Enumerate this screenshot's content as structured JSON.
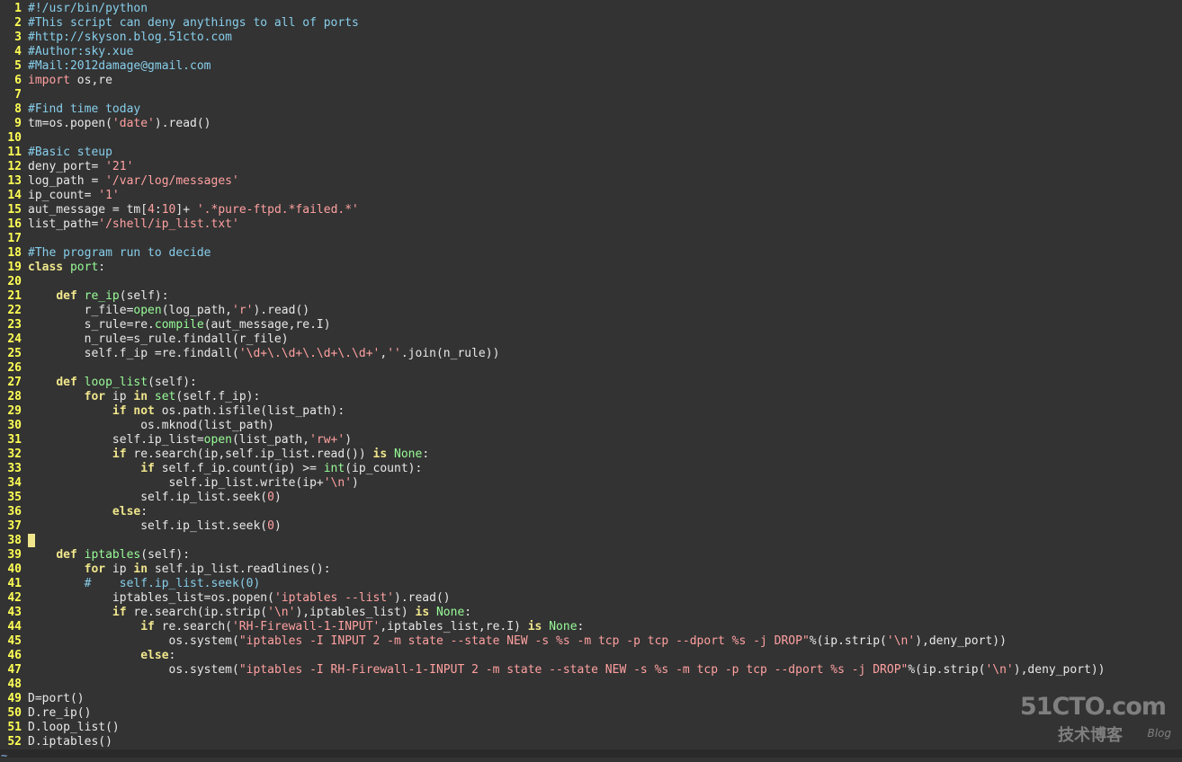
{
  "editor": {
    "lines": [
      {
        "n": "1",
        "code": [
          {
            "t": "cmt",
            "v": "#!/usr/bin/python"
          }
        ]
      },
      {
        "n": "2",
        "code": [
          {
            "t": "cmt",
            "v": "#This script can deny anythings to all of ports"
          }
        ]
      },
      {
        "n": "3",
        "code": [
          {
            "t": "cmt",
            "v": "#http://skyson.blog.51cto.com"
          }
        ]
      },
      {
        "n": "4",
        "code": [
          {
            "t": "cmt",
            "v": "#Author:sky.xue"
          }
        ]
      },
      {
        "n": "5",
        "code": [
          {
            "t": "cmt",
            "v": "#Mail:2012damage@gmail.com"
          }
        ]
      },
      {
        "n": "6",
        "code": [
          {
            "t": "str",
            "v": "import"
          },
          {
            "t": "code",
            "v": " os,re"
          }
        ]
      },
      {
        "n": "7",
        "code": []
      },
      {
        "n": "8",
        "code": [
          {
            "t": "cmt",
            "v": "#Find time today"
          }
        ]
      },
      {
        "n": "9",
        "code": [
          {
            "t": "code",
            "v": "tm=os.popen("
          },
          {
            "t": "str",
            "v": "'date'"
          },
          {
            "t": "code",
            "v": ").read()"
          }
        ]
      },
      {
        "n": "10",
        "code": []
      },
      {
        "n": "11",
        "code": [
          {
            "t": "cmt",
            "v": "#Basic steup"
          }
        ]
      },
      {
        "n": "12",
        "code": [
          {
            "t": "code",
            "v": "deny_port= "
          },
          {
            "t": "str",
            "v": "'21'"
          }
        ]
      },
      {
        "n": "13",
        "code": [
          {
            "t": "code",
            "v": "log_path = "
          },
          {
            "t": "str",
            "v": "'/var/log/messages'"
          }
        ]
      },
      {
        "n": "14",
        "code": [
          {
            "t": "code",
            "v": "ip_count= "
          },
          {
            "t": "str",
            "v": "'1'"
          }
        ]
      },
      {
        "n": "15",
        "code": [
          {
            "t": "code",
            "v": "aut_message = tm["
          },
          {
            "t": "num",
            "v": "4"
          },
          {
            "t": "code",
            "v": ":"
          },
          {
            "t": "num",
            "v": "10"
          },
          {
            "t": "code",
            "v": "]+ "
          },
          {
            "t": "str",
            "v": "'.*pure-ftpd.*failed.*'"
          }
        ]
      },
      {
        "n": "16",
        "code": [
          {
            "t": "code",
            "v": "list_path="
          },
          {
            "t": "str",
            "v": "'/shell/ip_list.txt'"
          }
        ]
      },
      {
        "n": "17",
        "code": []
      },
      {
        "n": "18",
        "code": [
          {
            "t": "cmt",
            "v": "#The program run to decide"
          }
        ]
      },
      {
        "n": "19",
        "code": [
          {
            "t": "kw",
            "v": "class"
          },
          {
            "t": "code",
            "v": " "
          },
          {
            "t": "fn",
            "v": "port"
          },
          {
            "t": "code",
            "v": ":"
          }
        ]
      },
      {
        "n": "20",
        "code": []
      },
      {
        "n": "21",
        "code": [
          {
            "t": "code",
            "v": "    "
          },
          {
            "t": "kw",
            "v": "def"
          },
          {
            "t": "code",
            "v": " "
          },
          {
            "t": "fn",
            "v": "re_ip"
          },
          {
            "t": "code",
            "v": "(self):"
          }
        ]
      },
      {
        "n": "22",
        "code": [
          {
            "t": "code",
            "v": "        r_file="
          },
          {
            "t": "bi",
            "v": "open"
          },
          {
            "t": "code",
            "v": "(log_path,"
          },
          {
            "t": "str",
            "v": "'r'"
          },
          {
            "t": "code",
            "v": ").read()"
          }
        ]
      },
      {
        "n": "23",
        "code": [
          {
            "t": "code",
            "v": "        s_rule=re."
          },
          {
            "t": "bi",
            "v": "compile"
          },
          {
            "t": "code",
            "v": "(aut_message,re.I)"
          }
        ]
      },
      {
        "n": "24",
        "code": [
          {
            "t": "code",
            "v": "        n_rule=s_rule.findall(r_file)"
          }
        ]
      },
      {
        "n": "25",
        "code": [
          {
            "t": "code",
            "v": "        self.f_ip =re.findall("
          },
          {
            "t": "str",
            "v": "'\\d+\\.\\d+\\.\\d+\\.\\d+'"
          },
          {
            "t": "code",
            "v": ","
          },
          {
            "t": "str",
            "v": "''"
          },
          {
            "t": "code",
            "v": ".join(n_rule))"
          }
        ]
      },
      {
        "n": "26",
        "code": []
      },
      {
        "n": "27",
        "code": [
          {
            "t": "code",
            "v": "    "
          },
          {
            "t": "kw",
            "v": "def"
          },
          {
            "t": "code",
            "v": " "
          },
          {
            "t": "fn",
            "v": "loop_list"
          },
          {
            "t": "code",
            "v": "(self):"
          }
        ]
      },
      {
        "n": "28",
        "code": [
          {
            "t": "code",
            "v": "        "
          },
          {
            "t": "kw",
            "v": "for"
          },
          {
            "t": "code",
            "v": " ip "
          },
          {
            "t": "kw",
            "v": "in"
          },
          {
            "t": "code",
            "v": " "
          },
          {
            "t": "bi",
            "v": "set"
          },
          {
            "t": "code",
            "v": "(self.f_ip):"
          }
        ]
      },
      {
        "n": "29",
        "code": [
          {
            "t": "code",
            "v": "            "
          },
          {
            "t": "kw",
            "v": "if"
          },
          {
            "t": "code",
            "v": " "
          },
          {
            "t": "kw",
            "v": "not"
          },
          {
            "t": "code",
            "v": " os.path.isfile(list_path):"
          }
        ]
      },
      {
        "n": "30",
        "code": [
          {
            "t": "code",
            "v": "                os.mknod(list_path)"
          }
        ]
      },
      {
        "n": "31",
        "code": [
          {
            "t": "code",
            "v": "            self.ip_list="
          },
          {
            "t": "bi",
            "v": "open"
          },
          {
            "t": "code",
            "v": "(list_path,"
          },
          {
            "t": "str",
            "v": "'rw+'"
          },
          {
            "t": "code",
            "v": ")"
          }
        ]
      },
      {
        "n": "32",
        "code": [
          {
            "t": "code",
            "v": "            "
          },
          {
            "t": "kw",
            "v": "if"
          },
          {
            "t": "code",
            "v": " re.search(ip,self.ip_list.read()) "
          },
          {
            "t": "kw",
            "v": "is"
          },
          {
            "t": "code",
            "v": " "
          },
          {
            "t": "bi",
            "v": "None"
          },
          {
            "t": "code",
            "v": ":"
          }
        ]
      },
      {
        "n": "33",
        "code": [
          {
            "t": "code",
            "v": "                "
          },
          {
            "t": "kw",
            "v": "if"
          },
          {
            "t": "code",
            "v": " self.f_ip.count(ip) >= "
          },
          {
            "t": "bi",
            "v": "int"
          },
          {
            "t": "code",
            "v": "(ip_count):"
          }
        ]
      },
      {
        "n": "34",
        "code": [
          {
            "t": "code",
            "v": "                    self.ip_list.write(ip+"
          },
          {
            "t": "str",
            "v": "'\\n'"
          },
          {
            "t": "code",
            "v": ")"
          }
        ]
      },
      {
        "n": "35",
        "code": [
          {
            "t": "code",
            "v": "                self.ip_list.seek("
          },
          {
            "t": "num",
            "v": "0"
          },
          {
            "t": "code",
            "v": ")"
          }
        ]
      },
      {
        "n": "36",
        "code": [
          {
            "t": "code",
            "v": "            "
          },
          {
            "t": "kw",
            "v": "else"
          },
          {
            "t": "code",
            "v": ":"
          }
        ]
      },
      {
        "n": "37",
        "code": [
          {
            "t": "code",
            "v": "                self.ip_list.seek("
          },
          {
            "t": "num",
            "v": "0"
          },
          {
            "t": "code",
            "v": ")"
          }
        ]
      },
      {
        "n": "38",
        "code": [
          {
            "t": "cursor",
            "v": ""
          }
        ]
      },
      {
        "n": "39",
        "code": [
          {
            "t": "code",
            "v": "    "
          },
          {
            "t": "kw",
            "v": "def"
          },
          {
            "t": "code",
            "v": " "
          },
          {
            "t": "fn",
            "v": "iptables"
          },
          {
            "t": "code",
            "v": "(self):"
          }
        ]
      },
      {
        "n": "40",
        "code": [
          {
            "t": "code",
            "v": "        "
          },
          {
            "t": "kw",
            "v": "for"
          },
          {
            "t": "code",
            "v": " ip "
          },
          {
            "t": "kw",
            "v": "in"
          },
          {
            "t": "code",
            "v": " self.ip_list.readlines():"
          }
        ]
      },
      {
        "n": "41",
        "code": [
          {
            "t": "code",
            "v": "        "
          },
          {
            "t": "cmt",
            "v": "#    self.ip_list.seek(0)"
          }
        ]
      },
      {
        "n": "42",
        "code": [
          {
            "t": "code",
            "v": "            iptables_list=os.popen("
          },
          {
            "t": "str",
            "v": "'iptables --list'"
          },
          {
            "t": "code",
            "v": ").read()"
          }
        ]
      },
      {
        "n": "43",
        "code": [
          {
            "t": "code",
            "v": "            "
          },
          {
            "t": "kw",
            "v": "if"
          },
          {
            "t": "code",
            "v": " re.search(ip.strip("
          },
          {
            "t": "str",
            "v": "'\\n'"
          },
          {
            "t": "code",
            "v": "),iptables_list) "
          },
          {
            "t": "kw",
            "v": "is"
          },
          {
            "t": "code",
            "v": " "
          },
          {
            "t": "bi",
            "v": "None"
          },
          {
            "t": "code",
            "v": ":"
          }
        ]
      },
      {
        "n": "44",
        "code": [
          {
            "t": "code",
            "v": "                "
          },
          {
            "t": "kw",
            "v": "if"
          },
          {
            "t": "code",
            "v": " re.search("
          },
          {
            "t": "str",
            "v": "'RH-Firewall-1-INPUT'"
          },
          {
            "t": "code",
            "v": ",iptables_list,re.I) "
          },
          {
            "t": "kw",
            "v": "is"
          },
          {
            "t": "code",
            "v": " "
          },
          {
            "t": "bi",
            "v": "None"
          },
          {
            "t": "code",
            "v": ":"
          }
        ]
      },
      {
        "n": "45",
        "code": [
          {
            "t": "code",
            "v": "                    os.system("
          },
          {
            "t": "str",
            "v": "\"iptables -I INPUT 2 -m state --state NEW -s %s -m tcp -p tcp --dport %s -j DROP\""
          },
          {
            "t": "code",
            "v": "%(ip.strip("
          },
          {
            "t": "str",
            "v": "'\\n'"
          },
          {
            "t": "code",
            "v": "),deny_port))"
          }
        ]
      },
      {
        "n": "46",
        "code": [
          {
            "t": "code",
            "v": "                "
          },
          {
            "t": "kw",
            "v": "else"
          },
          {
            "t": "code",
            "v": ":"
          }
        ]
      },
      {
        "n": "47",
        "code": [
          {
            "t": "code",
            "v": "                    os.system("
          },
          {
            "t": "str",
            "v": "\"iptables -I RH-Firewall-1-INPUT 2 -m state --state NEW -s %s -m tcp -p tcp --dport %s -j DROP\""
          },
          {
            "t": "code",
            "v": "%(ip.strip("
          },
          {
            "t": "str",
            "v": "'\\n'"
          },
          {
            "t": "code",
            "v": "),deny_port))"
          }
        ]
      },
      {
        "n": "48",
        "code": []
      },
      {
        "n": "49",
        "code": [
          {
            "t": "code",
            "v": "D=port()"
          }
        ]
      },
      {
        "n": "50",
        "code": [
          {
            "t": "code",
            "v": "D.re_ip()"
          }
        ]
      },
      {
        "n": "51",
        "code": [
          {
            "t": "code",
            "v": "D.loop_list()"
          }
        ]
      },
      {
        "n": "52",
        "code": [
          {
            "t": "code",
            "v": "D.iptables()"
          }
        ]
      }
    ],
    "tilde": "~"
  },
  "watermark": {
    "top": "51CTO.com",
    "bottom": "技术博客",
    "blog": "Blog"
  },
  "colors": {
    "background": "#333333",
    "line_number": "#ffff55",
    "comment": "#87ceeb",
    "keyword": "#f0e68c",
    "string": "#ffa0a0",
    "builtin": "#98fb98",
    "text": "#e8e8e8"
  }
}
